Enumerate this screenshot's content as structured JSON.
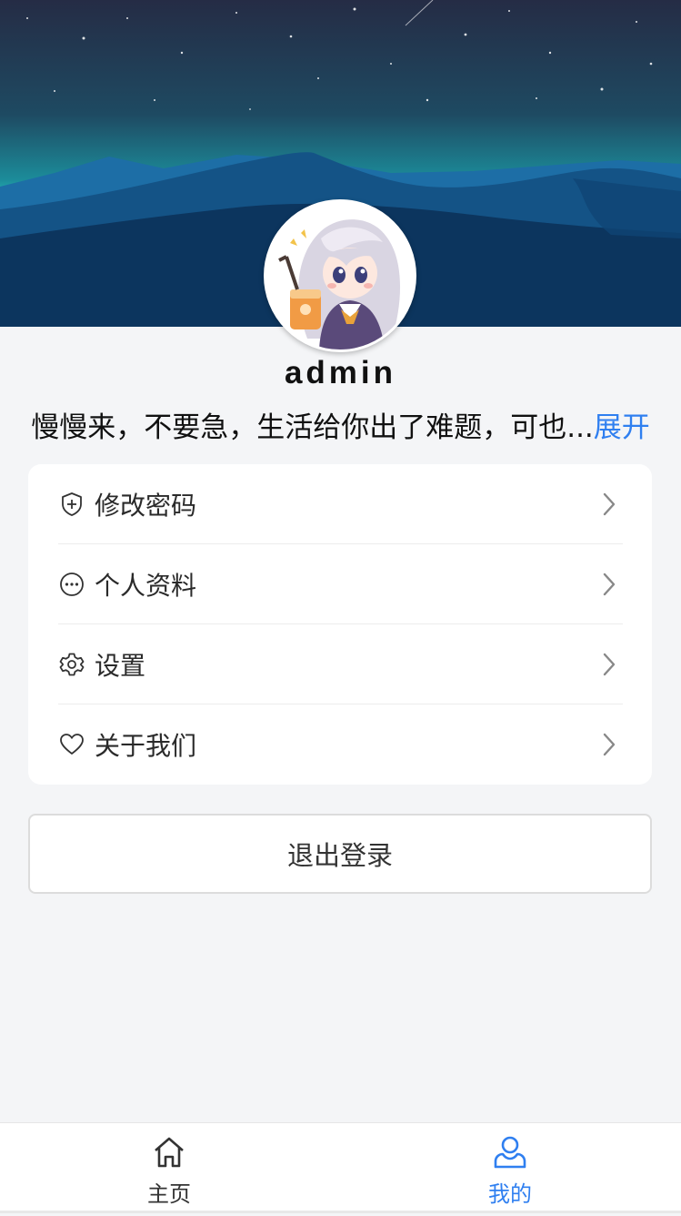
{
  "profile": {
    "username": "admin",
    "bio": "慢慢来，不要急，生活给你出了难题，可也...",
    "expand_label": "展开"
  },
  "menu": [
    {
      "icon": "shield-plus-icon",
      "label": "修改密码"
    },
    {
      "icon": "more-circle-icon",
      "label": "个人资料"
    },
    {
      "icon": "gear-icon",
      "label": "设置"
    },
    {
      "icon": "heart-icon",
      "label": "关于我们"
    }
  ],
  "logout_label": "退出登录",
  "tabbar": {
    "home_label": "主页",
    "mine_label": "我的",
    "active": "mine"
  },
  "colors": {
    "accent": "#2f7ff0",
    "sky_top": "#1f2a44",
    "sky_glow": "#23c1c0",
    "dune": "#0d3a64",
    "background": "#f4f5f7"
  }
}
